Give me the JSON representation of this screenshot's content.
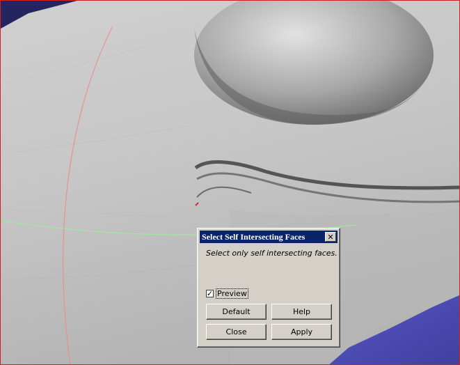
{
  "dialog": {
    "title": "Select Self Intersecting Faces",
    "close_icon": "close-icon",
    "description": "Select only self intersecting faces.",
    "preview": {
      "label": "Preview",
      "checked": true
    },
    "buttons": {
      "default_label": "Default",
      "help_label": "Help",
      "close_label": "Close",
      "apply_label": "Apply"
    }
  },
  "colors": {
    "background": "#2a2a6e",
    "mesh": "#c4c4c4",
    "floor": "#5555bb",
    "title_bar": "#0a246a",
    "dialog_face": "#d4d0c8",
    "red_curve": "#e89090",
    "green_curve": "#a0e8a0"
  }
}
